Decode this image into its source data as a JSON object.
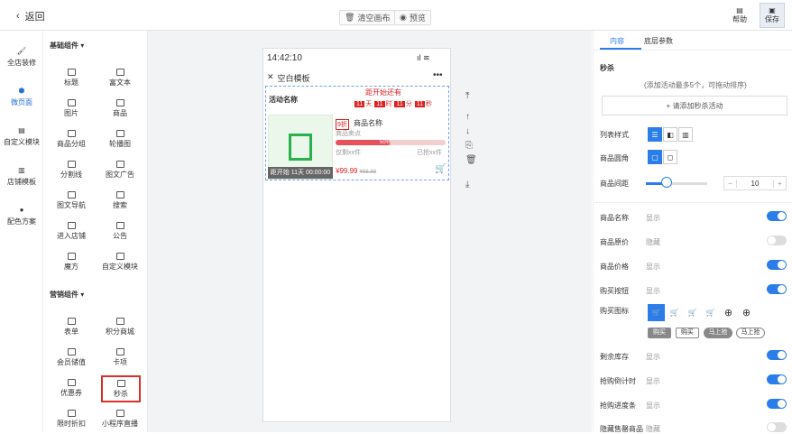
{
  "topbar": {
    "back": "返回",
    "clear": "清空画布",
    "preview": "预览",
    "help": "帮助",
    "save": "保存"
  },
  "leftnav": [
    "全店装修",
    "微页面",
    "自定义模块",
    "店铺模板",
    "配色方案"
  ],
  "basic": {
    "title": "基础组件",
    "items": [
      "标题",
      "富文本",
      "图片",
      "商品",
      "商品分组",
      "轮播图",
      "分割线",
      "图文广告",
      "图文导航",
      "搜索",
      "进入店铺",
      "公告",
      "魔方",
      "自定义模块"
    ]
  },
  "market": {
    "title": "营销组件",
    "items": [
      "表单",
      "积分商城",
      "会员储值",
      "卡项",
      "优惠券",
      "秒杀",
      "限时折扣",
      "小程序直播"
    ]
  },
  "phone": {
    "time": "14:42:10",
    "title": "空白模板",
    "activity": "活动名称",
    "countdown_label": "距开始还有",
    "cd": [
      "11",
      "天",
      "11",
      "时",
      "11",
      "分",
      "11",
      "秒"
    ],
    "discount": "9折",
    "name": "商品名称",
    "selling": "商品卖点",
    "progress": "50%",
    "remain": "仅剩xx件",
    "sold": "已抢xx件",
    "start_tag": "距开始 11天 00:00:00",
    "price": "¥99.99",
    "orig": "¥88.88"
  },
  "right": {
    "tabs": [
      "内容",
      "底层参数"
    ],
    "section": "秒杀",
    "hint": "(添加活动最多5个，可拖动排序)",
    "add": "+ 请添加秒杀活动",
    "list_style": "列表样式",
    "corner": "商品圆角",
    "gap": "商品间距",
    "gap_value": "10",
    "rows": [
      {
        "label": "商品名称",
        "value": "显示",
        "on": true
      },
      {
        "label": "商品原价",
        "value": "隐藏",
        "on": false
      },
      {
        "label": "商品价格",
        "value": "显示",
        "on": true
      },
      {
        "label": "购买按钮",
        "value": "显示",
        "on": true
      }
    ],
    "buy_icon": "购买图标",
    "buy_texts": [
      "购买",
      "购买",
      "马上抢",
      "马上抢"
    ],
    "rows2": [
      {
        "label": "剩余库存",
        "value": "显示",
        "on": true
      },
      {
        "label": "抢购倒计时",
        "value": "显示",
        "on": true
      },
      {
        "label": "抢购进度条",
        "value": "显示",
        "on": true
      },
      {
        "label": "隐藏售罄商品",
        "value": "隐藏",
        "on": false
      }
    ]
  },
  "colors": {
    "accent": "#2b7de9",
    "danger": "#e02020",
    "highlight": "#d9302c"
  }
}
